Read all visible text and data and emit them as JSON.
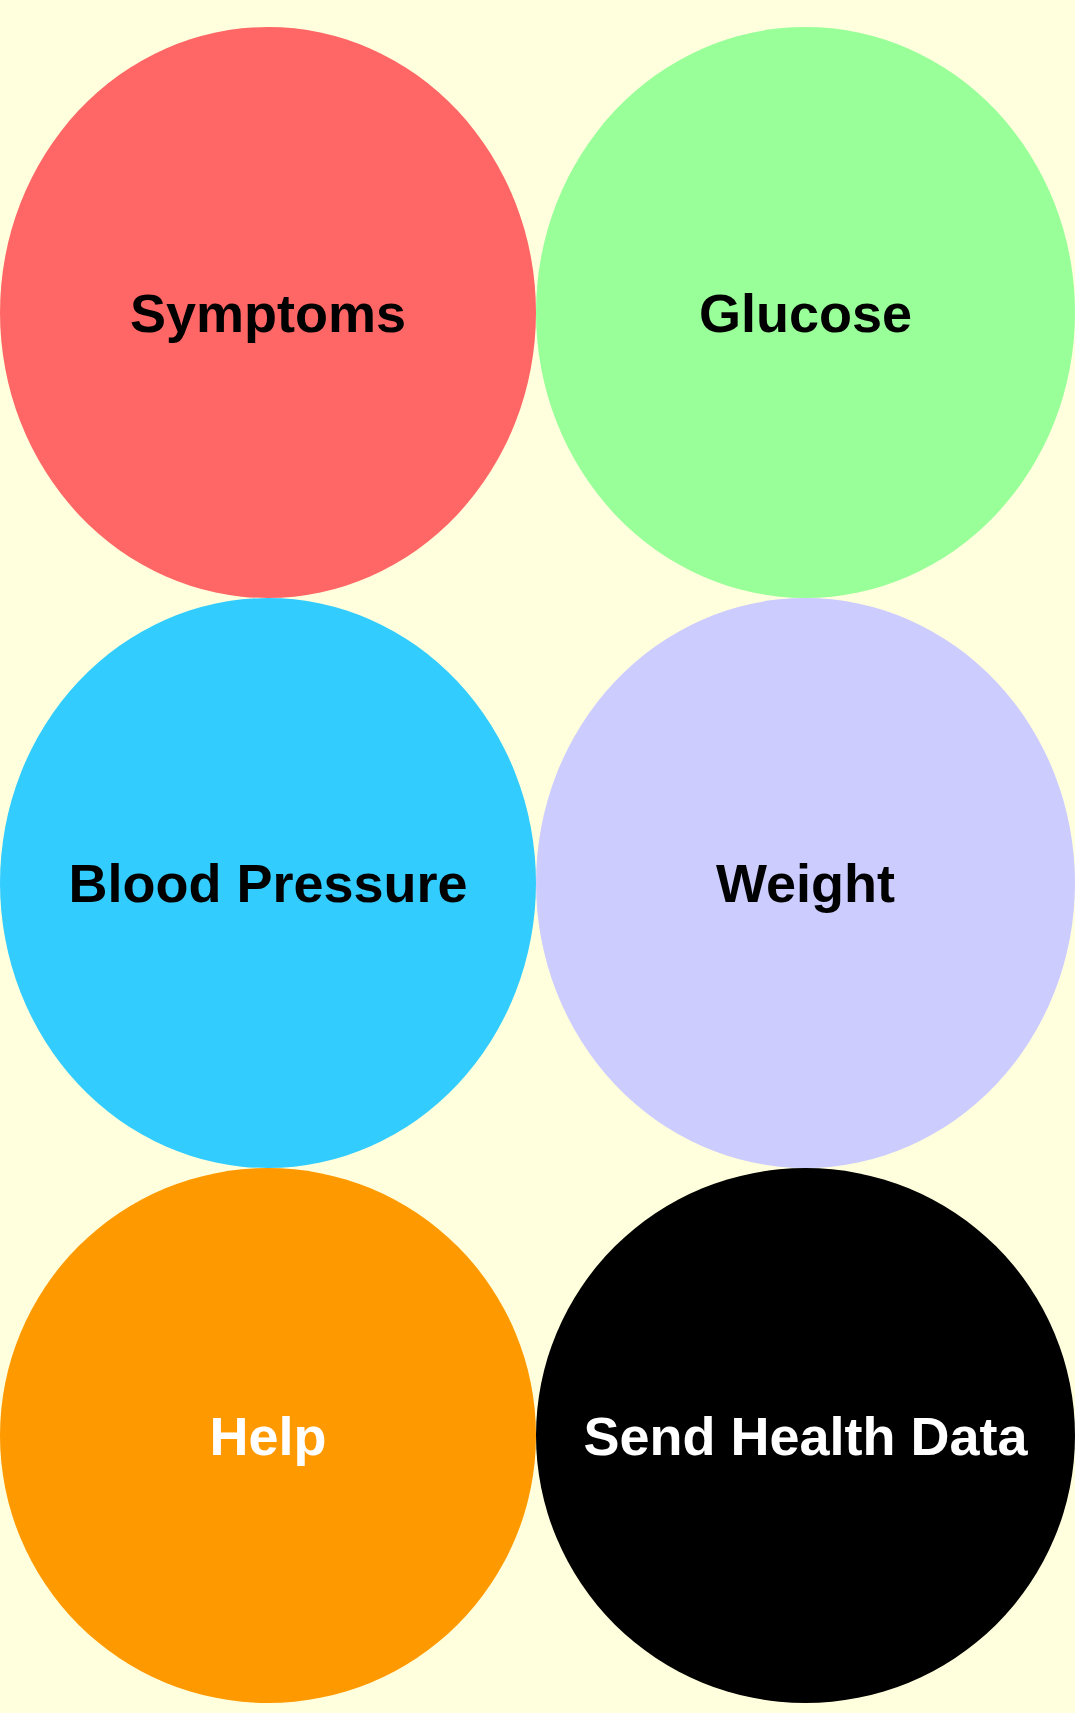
{
  "buttons": [
    {
      "label": "Symptoms",
      "color": "#ff6666",
      "kind": "entry"
    },
    {
      "label": "Glucose",
      "color": "#99ff99",
      "kind": "entry"
    },
    {
      "label": "Blood Pressure",
      "color": "#33ccff",
      "kind": "entry"
    },
    {
      "label": "Weight",
      "color": "#ccccff",
      "kind": "entry"
    },
    {
      "label": "Help",
      "color": "#ff9900",
      "kind": "action"
    },
    {
      "label": "Send Health Data",
      "color": "#000000",
      "kind": "action"
    }
  ]
}
